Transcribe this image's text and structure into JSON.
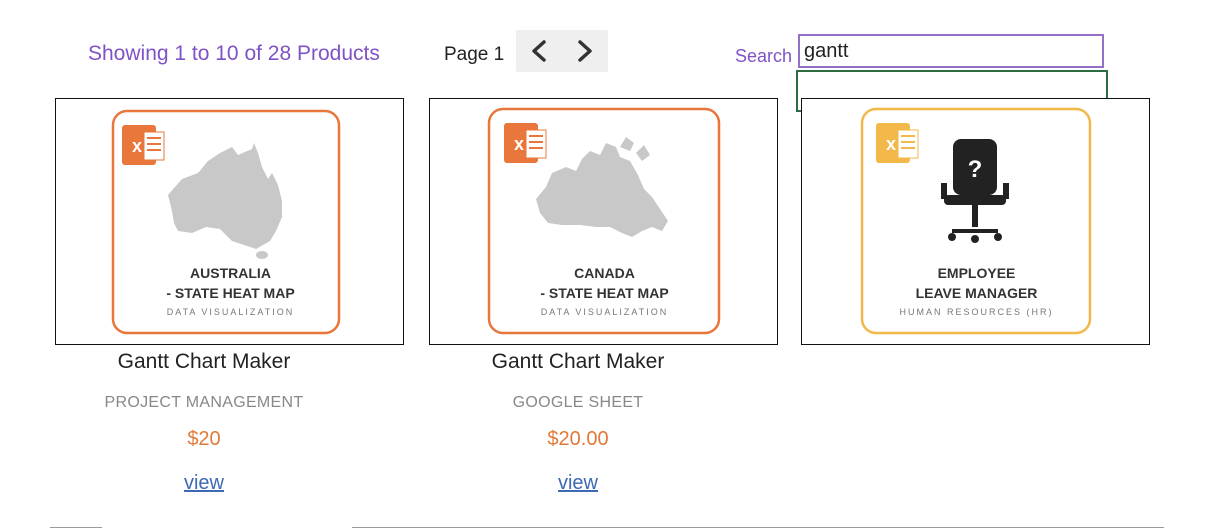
{
  "header": {
    "showing_text": "Showing 1 to 10 of 28 Products",
    "page_label": "Page 1",
    "search_label": "Search",
    "search_value": "gantt"
  },
  "products": [
    {
      "thumb_title_line1": "AUSTRALIA",
      "thumb_title_line2": "- STATE HEAT MAP",
      "thumb_category": "DATA VISUALIZATION",
      "title": "Gantt Chart Maker",
      "category": "PROJECT MANAGEMENT",
      "price": "$20",
      "link": "view"
    },
    {
      "thumb_title_line1": "CANADA",
      "thumb_title_line2": "- STATE HEAT MAP",
      "thumb_category": "DATA VISUALIZATION",
      "title": "Gantt Chart Maker",
      "category": "GOOGLE SHEET",
      "price": "$20.00",
      "link": "view"
    },
    {
      "thumb_title_line1": "EMPLOYEE",
      "thumb_title_line2": "LEAVE MANAGER",
      "thumb_category": "HUMAN RESOURCES (HR)"
    }
  ],
  "colors": {
    "accent_purple": "#7f52c6",
    "price_orange": "#e07a38",
    "link_blue": "#3d6ab3",
    "excel_orange": "#e9763a",
    "hr_yellow": "#f3b84a"
  }
}
